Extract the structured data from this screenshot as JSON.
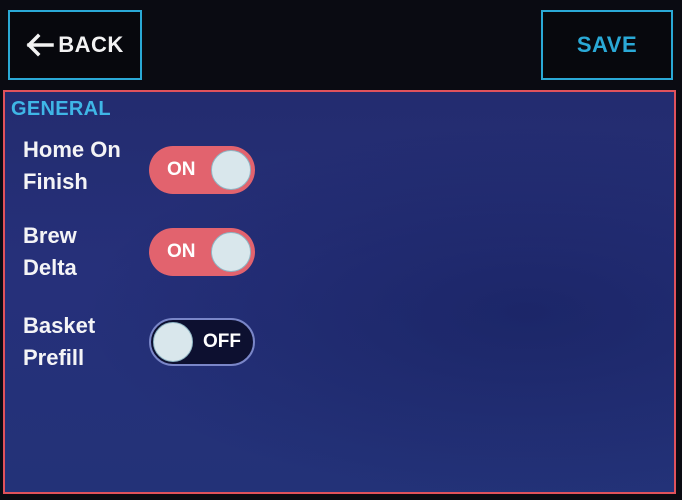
{
  "header": {
    "back_label": "BACK",
    "save_label": "SAVE"
  },
  "section": {
    "title": "GENERAL"
  },
  "settings": [
    {
      "label_line1": "Home On",
      "label_line2": "Finish",
      "state": "ON",
      "enabled": true
    },
    {
      "label_line1": "Brew",
      "label_line2": "Delta",
      "state": "ON",
      "enabled": true
    },
    {
      "label_line1": "Basket",
      "label_line2": "Prefill",
      "state": "OFF",
      "enabled": false
    }
  ],
  "colors": {
    "accent": "#2aa9d6",
    "panel_border": "#e0525c",
    "toggle_on": "#e2636e",
    "toggle_off": "#0d1030",
    "panel_bg": "#26307a"
  },
  "icons": {
    "back": "arrow-left-icon"
  }
}
